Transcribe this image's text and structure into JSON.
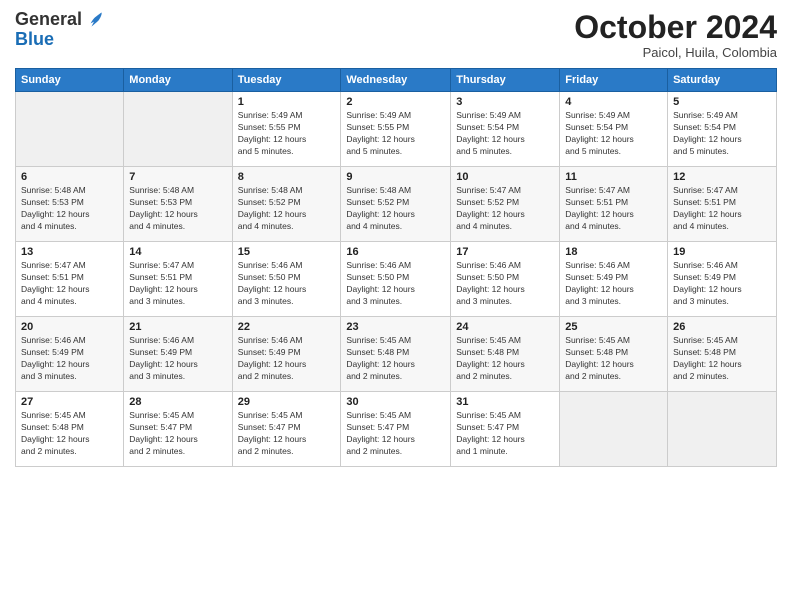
{
  "header": {
    "logo_general": "General",
    "logo_blue": "Blue",
    "month_title": "October 2024",
    "location": "Paicol, Huila, Colombia"
  },
  "weekdays": [
    "Sunday",
    "Monday",
    "Tuesday",
    "Wednesday",
    "Thursday",
    "Friday",
    "Saturday"
  ],
  "weeks": [
    [
      {
        "day": "",
        "info": ""
      },
      {
        "day": "",
        "info": ""
      },
      {
        "day": "1",
        "info": "Sunrise: 5:49 AM\nSunset: 5:55 PM\nDaylight: 12 hours\nand 5 minutes."
      },
      {
        "day": "2",
        "info": "Sunrise: 5:49 AM\nSunset: 5:55 PM\nDaylight: 12 hours\nand 5 minutes."
      },
      {
        "day": "3",
        "info": "Sunrise: 5:49 AM\nSunset: 5:54 PM\nDaylight: 12 hours\nand 5 minutes."
      },
      {
        "day": "4",
        "info": "Sunrise: 5:49 AM\nSunset: 5:54 PM\nDaylight: 12 hours\nand 5 minutes."
      },
      {
        "day": "5",
        "info": "Sunrise: 5:49 AM\nSunset: 5:54 PM\nDaylight: 12 hours\nand 5 minutes."
      }
    ],
    [
      {
        "day": "6",
        "info": "Sunrise: 5:48 AM\nSunset: 5:53 PM\nDaylight: 12 hours\nand 4 minutes."
      },
      {
        "day": "7",
        "info": "Sunrise: 5:48 AM\nSunset: 5:53 PM\nDaylight: 12 hours\nand 4 minutes."
      },
      {
        "day": "8",
        "info": "Sunrise: 5:48 AM\nSunset: 5:52 PM\nDaylight: 12 hours\nand 4 minutes."
      },
      {
        "day": "9",
        "info": "Sunrise: 5:48 AM\nSunset: 5:52 PM\nDaylight: 12 hours\nand 4 minutes."
      },
      {
        "day": "10",
        "info": "Sunrise: 5:47 AM\nSunset: 5:52 PM\nDaylight: 12 hours\nand 4 minutes."
      },
      {
        "day": "11",
        "info": "Sunrise: 5:47 AM\nSunset: 5:51 PM\nDaylight: 12 hours\nand 4 minutes."
      },
      {
        "day": "12",
        "info": "Sunrise: 5:47 AM\nSunset: 5:51 PM\nDaylight: 12 hours\nand 4 minutes."
      }
    ],
    [
      {
        "day": "13",
        "info": "Sunrise: 5:47 AM\nSunset: 5:51 PM\nDaylight: 12 hours\nand 4 minutes."
      },
      {
        "day": "14",
        "info": "Sunrise: 5:47 AM\nSunset: 5:51 PM\nDaylight: 12 hours\nand 3 minutes."
      },
      {
        "day": "15",
        "info": "Sunrise: 5:46 AM\nSunset: 5:50 PM\nDaylight: 12 hours\nand 3 minutes."
      },
      {
        "day": "16",
        "info": "Sunrise: 5:46 AM\nSunset: 5:50 PM\nDaylight: 12 hours\nand 3 minutes."
      },
      {
        "day": "17",
        "info": "Sunrise: 5:46 AM\nSunset: 5:50 PM\nDaylight: 12 hours\nand 3 minutes."
      },
      {
        "day": "18",
        "info": "Sunrise: 5:46 AM\nSunset: 5:49 PM\nDaylight: 12 hours\nand 3 minutes."
      },
      {
        "day": "19",
        "info": "Sunrise: 5:46 AM\nSunset: 5:49 PM\nDaylight: 12 hours\nand 3 minutes."
      }
    ],
    [
      {
        "day": "20",
        "info": "Sunrise: 5:46 AM\nSunset: 5:49 PM\nDaylight: 12 hours\nand 3 minutes."
      },
      {
        "day": "21",
        "info": "Sunrise: 5:46 AM\nSunset: 5:49 PM\nDaylight: 12 hours\nand 3 minutes."
      },
      {
        "day": "22",
        "info": "Sunrise: 5:46 AM\nSunset: 5:49 PM\nDaylight: 12 hours\nand 2 minutes."
      },
      {
        "day": "23",
        "info": "Sunrise: 5:45 AM\nSunset: 5:48 PM\nDaylight: 12 hours\nand 2 minutes."
      },
      {
        "day": "24",
        "info": "Sunrise: 5:45 AM\nSunset: 5:48 PM\nDaylight: 12 hours\nand 2 minutes."
      },
      {
        "day": "25",
        "info": "Sunrise: 5:45 AM\nSunset: 5:48 PM\nDaylight: 12 hours\nand 2 minutes."
      },
      {
        "day": "26",
        "info": "Sunrise: 5:45 AM\nSunset: 5:48 PM\nDaylight: 12 hours\nand 2 minutes."
      }
    ],
    [
      {
        "day": "27",
        "info": "Sunrise: 5:45 AM\nSunset: 5:48 PM\nDaylight: 12 hours\nand 2 minutes."
      },
      {
        "day": "28",
        "info": "Sunrise: 5:45 AM\nSunset: 5:47 PM\nDaylight: 12 hours\nand 2 minutes."
      },
      {
        "day": "29",
        "info": "Sunrise: 5:45 AM\nSunset: 5:47 PM\nDaylight: 12 hours\nand 2 minutes."
      },
      {
        "day": "30",
        "info": "Sunrise: 5:45 AM\nSunset: 5:47 PM\nDaylight: 12 hours\nand 2 minutes."
      },
      {
        "day": "31",
        "info": "Sunrise: 5:45 AM\nSunset: 5:47 PM\nDaylight: 12 hours\nand 1 minute."
      },
      {
        "day": "",
        "info": ""
      },
      {
        "day": "",
        "info": ""
      }
    ]
  ]
}
